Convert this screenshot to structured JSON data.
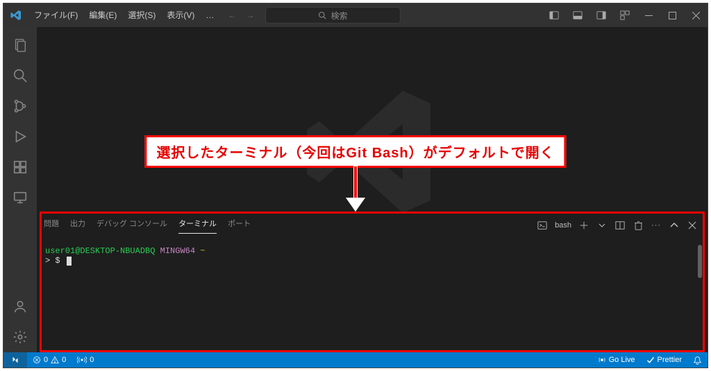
{
  "menu": {
    "file": "ファイル(F)",
    "edit": "編集(E)",
    "select": "選択(S)",
    "view": "表示(V)",
    "overflow": "…"
  },
  "search": {
    "placeholder": "検索"
  },
  "panel": {
    "tabs": {
      "problems": "問題",
      "output": "出力",
      "debug": "デバッグ コンソール",
      "terminal": "ターミナル",
      "ports": "ポート"
    },
    "shellLabel": "bash"
  },
  "terminal": {
    "userHost": "user01@DESKTOP-NBUADBQ",
    "env": "MINGW64",
    "cwd": "~",
    "promptPrefix": ">",
    "promptSymbol": "$"
  },
  "annotation": {
    "text": "選択したターミナル（今回はGit Bash）がデフォルトで開く"
  },
  "status": {
    "errors": "0",
    "warnings": "0",
    "ports": "0",
    "goLive": "Go Live",
    "prettier": "Prettier"
  }
}
